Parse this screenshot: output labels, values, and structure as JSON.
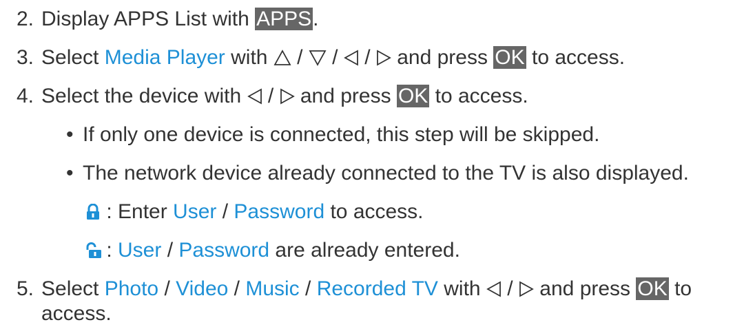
{
  "steps": [
    {
      "num": "2.",
      "prefix": "Display APPS List with ",
      "key": "APPS",
      "suffix": "."
    },
    {
      "num": "3.",
      "select": "Select ",
      "target": "Media Player",
      "with": " with ",
      "sep": " / ",
      "and_press": " and press ",
      "key": "OK",
      "to_access": " to access."
    },
    {
      "num": "4.",
      "text": "Select the device with ",
      "sep": " / ",
      "and_press": " and press ",
      "key": "OK",
      "to_access": " to access."
    },
    {
      "num": "5.",
      "select": "Select ",
      "options": [
        "Photo",
        "Video",
        "Music",
        "Recorded TV"
      ],
      "sep": " / ",
      "with": " with ",
      "and_press": " and press ",
      "key": "OK",
      "to": " to",
      "cont": "access."
    }
  ],
  "bullets": [
    {
      "mark": "•",
      "text": "If only one device is connected, this step will be skipped."
    },
    {
      "mark": "•",
      "text": "The network device already connected to the TV is also displayed."
    }
  ],
  "lock_notes": [
    {
      "icon": "locked-icon",
      "colon": " : Enter ",
      "user": "User",
      "sep": " / ",
      "password": "Password",
      "tail": " to access."
    },
    {
      "icon": "unlocked-icon",
      "colon": " : ",
      "user": "User",
      "sep": " / ",
      "password": "Password",
      "tail": " are already entered."
    }
  ],
  "colors": {
    "link": "#1e90d6",
    "key_bg": "#666666",
    "icon": "#1e90d6"
  }
}
